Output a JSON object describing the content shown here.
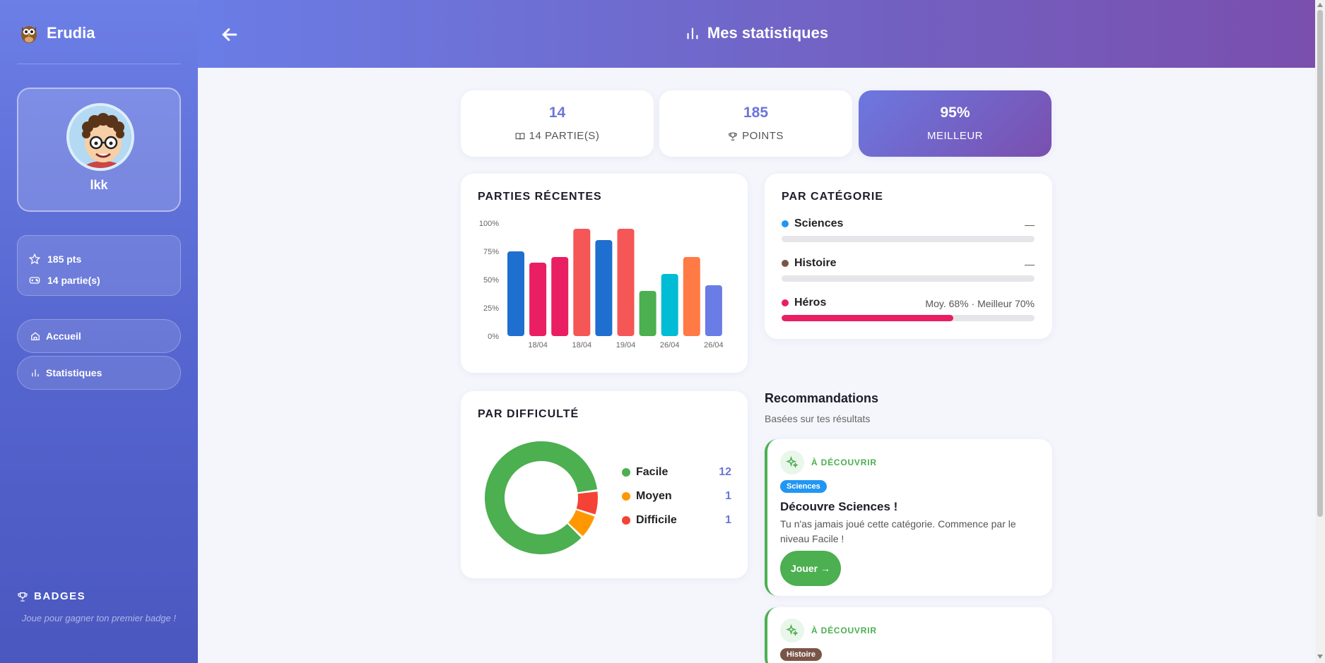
{
  "app": {
    "name": "Erudia"
  },
  "header": {
    "title": "Mes statistiques"
  },
  "profile": {
    "username": "lkk",
    "points": "185 pts",
    "games": "14 partie(s)"
  },
  "nav": [
    {
      "label": "Accueil",
      "icon": "home-icon"
    },
    {
      "label": "Statistiques",
      "icon": "bar-chart-icon"
    }
  ],
  "badges": {
    "title": "BADGES",
    "empty_text": "Joue pour gagner ton premier badge !"
  },
  "kpis": [
    {
      "value": "14",
      "label": "14 PARTIE(S)",
      "icon": "book-icon"
    },
    {
      "value": "185",
      "label": "POINTS",
      "icon": "trophy-icon"
    },
    {
      "value": "95%",
      "label": "MEILLEUR"
    }
  ],
  "recent": {
    "title": "PARTIES RÉCENTES"
  },
  "categories": {
    "title": "PAR CATÉGORIE",
    "items": [
      {
        "name": "Sciences",
        "detail": "—",
        "color": "#2196f3",
        "fill": 0
      },
      {
        "name": "Histoire",
        "detail": "—",
        "color": "#795548",
        "fill": 0
      },
      {
        "name": "Héros",
        "detail": "Moy. 68% · Meilleur 70%",
        "color": "#e91e63",
        "fill": 0.68
      }
    ]
  },
  "difficulty": {
    "title": "PAR DIFFICULTÉ",
    "items": [
      {
        "label": "Facile",
        "count": "12",
        "color": "#4caf50"
      },
      {
        "label": "Moyen",
        "count": "1",
        "color": "#ff9800"
      },
      {
        "label": "Difficile",
        "count": "1",
        "color": "#f44336"
      }
    ]
  },
  "recommendations": {
    "title": "Recommandations",
    "subtitle": "Basées sur tes résultats",
    "items": [
      {
        "tag": "À DÉCOUVRIR",
        "category": "Sciences",
        "category_color": "#2196f3",
        "title": "Découvre Sciences !",
        "text": "Tu n'as jamais joué cette catégorie. Commence par le niveau Facile !",
        "button": "Jouer →"
      },
      {
        "tag": "À DÉCOUVRIR",
        "category": "Histoire",
        "category_color": "#795548"
      }
    ]
  },
  "chart_data": {
    "type": "bar",
    "title": "PARTIES RÉCENTES",
    "y_ticks": [
      "100%",
      "75%",
      "50%",
      "25%",
      "0%"
    ],
    "ylim": [
      0,
      100
    ],
    "x_tick_labels": [
      "18/04",
      "18/04",
      "19/04",
      "26/04",
      "26/04"
    ],
    "values": [
      75,
      65,
      70,
      95,
      85,
      95,
      40,
      55,
      70,
      45
    ],
    "colors": [
      "#1e6fcf",
      "#e91e63",
      "#e91e63",
      "#f55656",
      "#1e6fcf",
      "#f55656",
      "#4caf50",
      "#00bcd4",
      "#ff7a45",
      "#6a7de6"
    ]
  }
}
